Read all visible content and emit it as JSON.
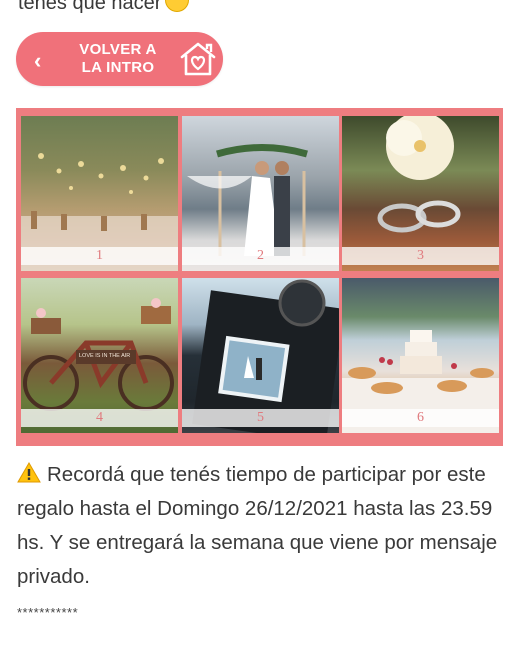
{
  "top": {
    "partial_text": "tenés que hacer"
  },
  "back_button": {
    "label": "VOLVER A LA INTRO"
  },
  "collage": {
    "tiles": [
      {
        "number": "1"
      },
      {
        "number": "2"
      },
      {
        "number": "3"
      },
      {
        "number": "4"
      },
      {
        "number": "5"
      },
      {
        "number": "6"
      }
    ],
    "tile4_sign": "LOVE IS IN THE AIR"
  },
  "message": {
    "text": "Recordá que tenés tiempo de participar por este regalo hasta el Domingo 26/12/2021 hasta las 23.59 hs. Y se entregará la semana que viene por mensaje privado."
  },
  "separator": "***********",
  "colors": {
    "accent": "#f0717a",
    "collage_border": "#ee7d80"
  },
  "icons": [
    "chevron-left-icon",
    "house-heart-icon",
    "warning-icon",
    "grinning-emoji-icon"
  ]
}
